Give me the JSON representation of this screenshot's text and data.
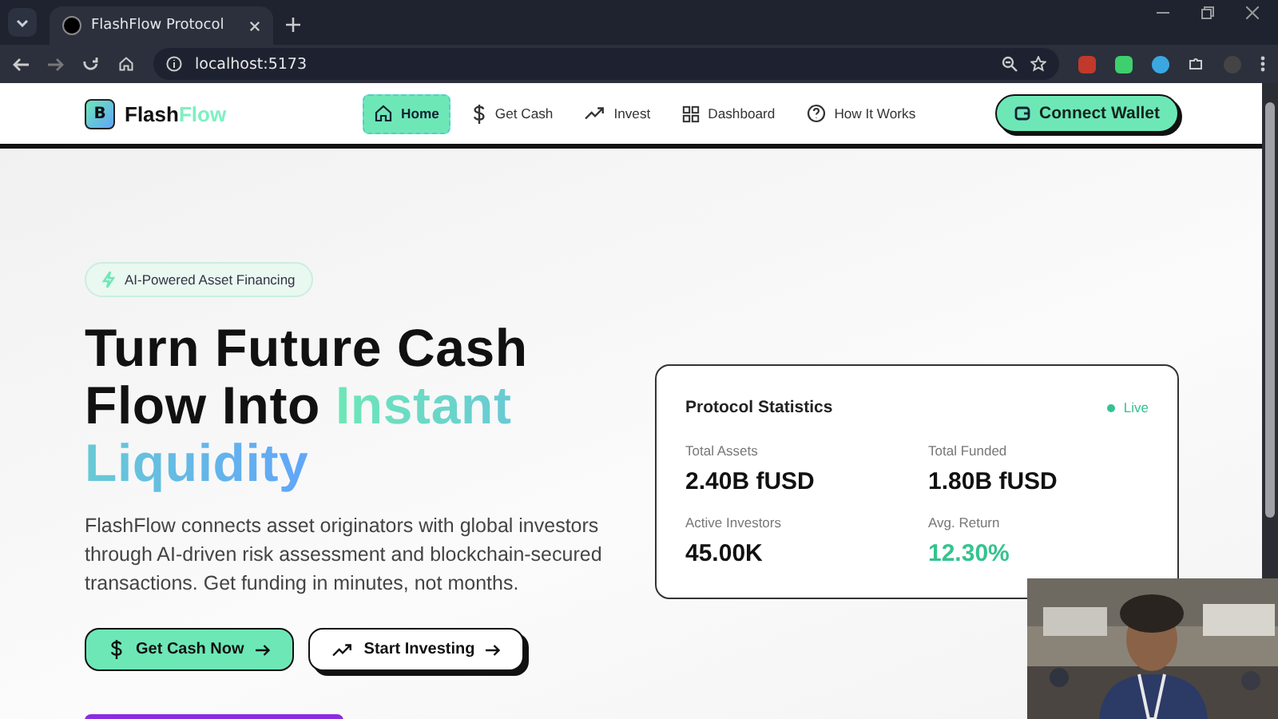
{
  "browser": {
    "tab_title": "FlashFlow Protocol",
    "url": "localhost:5173"
  },
  "navbar": {
    "brand": {
      "mark": "B",
      "name_dark": "Flash",
      "name_accent": "Flow"
    },
    "links": [
      {
        "label": "Home",
        "selected": true
      },
      {
        "label": "Get Cash",
        "selected": false
      },
      {
        "label": "Invest",
        "selected": false
      },
      {
        "label": "Dashboard",
        "selected": false
      },
      {
        "label": "How It Works",
        "selected": false
      }
    ],
    "connect_button": "Connect Wallet"
  },
  "hero": {
    "badge": "AI-Powered Asset Financing",
    "headline": "Turn Future Cash Flow Into",
    "headline_highlight": "Instant Liquidity",
    "description": "FlashFlow connects asset originators with global investors through AI-driven risk assessment and blockchain-secured transactions. Get funding in minutes, not months.",
    "buttons": [
      {
        "label": "Get Cash Now",
        "kind": "primary"
      },
      {
        "label": "Start Investing",
        "kind": "outline"
      }
    ]
  },
  "stats": {
    "title": "Protocol Statistics",
    "status": "Live",
    "items": [
      {
        "label": "Total Assets",
        "value": "2.40B fUSD",
        "highlight": false
      },
      {
        "label": "Total Funded",
        "value": "1.80B fUSD",
        "highlight": false
      },
      {
        "label": "Active Investors",
        "value": "45.00K",
        "highlight": false
      },
      {
        "label": "Avg. Return",
        "value": "12.30%",
        "highlight": true
      }
    ]
  }
}
